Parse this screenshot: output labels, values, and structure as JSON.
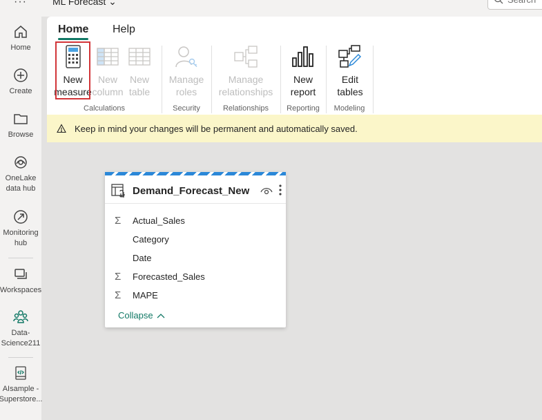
{
  "topbar": {
    "title": "ML Forecast ⌄",
    "search_placeholder": "Search"
  },
  "rail": {
    "more": "···",
    "items": [
      {
        "label": "Home",
        "icon": "home-icon"
      },
      {
        "label": "Create",
        "icon": "plus-circle-icon"
      },
      {
        "label": "Browse",
        "icon": "folder-icon"
      },
      {
        "label": "OneLake\ndata hub",
        "icon": "onelake-icon"
      },
      {
        "label": "Monitoring\nhub",
        "icon": "monitor-icon"
      },
      {
        "label": "Workspaces",
        "icon": "workspaces-icon"
      },
      {
        "label": "Data-\nScience211",
        "icon": "people-icon"
      },
      {
        "label": "AIsample -\nSuperstore...",
        "icon": "notebook-icon"
      }
    ]
  },
  "ribbon": {
    "tabs": [
      "Home",
      "Help"
    ],
    "buttons": {
      "new_measure": "New\nmeasure",
      "new_column": "New\ncolumn",
      "new_table": "New\ntable",
      "manage_roles": "Manage\nroles",
      "manage_relationships": "Manage\nrelationships",
      "new_report": "New\nreport",
      "edit_tables": "Edit\ntables"
    },
    "groups": {
      "calculations": "Calculations",
      "security": "Security",
      "relationships": "Relationships",
      "reporting": "Reporting",
      "modeling": "Modeling"
    }
  },
  "warning": {
    "text": "Keep in mind your changes will be permanent and automatically saved."
  },
  "table_card": {
    "title": "Demand_Forecast_New",
    "fields": [
      {
        "name": "Actual_Sales",
        "sigma": "Σ"
      },
      {
        "name": "Category",
        "sigma": ""
      },
      {
        "name": "Date",
        "sigma": ""
      },
      {
        "name": "Forecasted_Sales",
        "sigma": "Σ"
      },
      {
        "name": "MAPE",
        "sigma": "Σ"
      }
    ],
    "collapse_label": "Collapse"
  },
  "colors": {
    "accent": "#117865",
    "highlight": "#d13438",
    "warning_bg": "#fbf6c9",
    "stripe": "#2b88d8"
  }
}
